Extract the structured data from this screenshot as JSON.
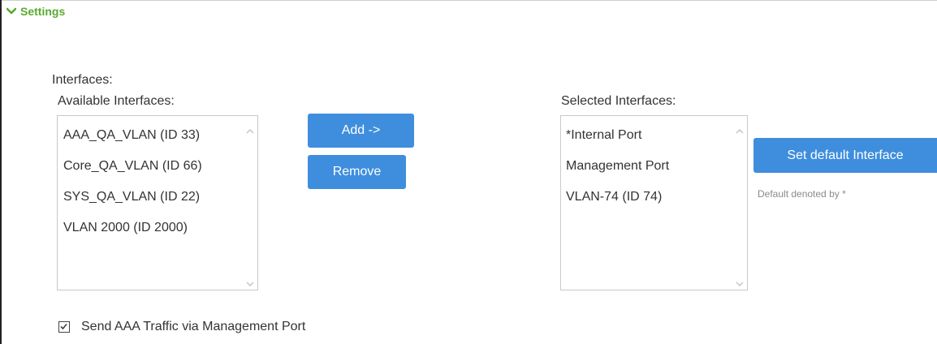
{
  "section": {
    "title": "Settings",
    "expanded": true
  },
  "interfaces": {
    "heading": "Interfaces:",
    "available_label": "Available Interfaces:",
    "available_items": [
      "AAA_QA_VLAN (ID 33)",
      "Core_QA_VLAN (ID 66)",
      "SYS_QA_VLAN (ID 22)",
      "VLAN 2000 (ID 2000)"
    ],
    "selected_label": "Selected Interfaces:",
    "selected_items": [
      "*Internal Port",
      "Management Port",
      "VLAN-74 (ID 74)"
    ],
    "add_label": "Add ->",
    "remove_label": "Remove",
    "set_default_label": "Set default Interface",
    "default_hint": "Default denoted by *"
  },
  "options": {
    "send_aaa_label": "Send AAA Traffic via Management Port",
    "send_aaa_checked": true
  },
  "colors": {
    "accent_green": "#5aaa2e",
    "button_blue": "#3f8ede"
  },
  "icons": {
    "section_toggle": "chevron-down-icon",
    "scroll_up": "scroll-up-arrow-icon",
    "scroll_down": "scroll-down-arrow-icon",
    "checkbox": "checkmark-icon"
  }
}
